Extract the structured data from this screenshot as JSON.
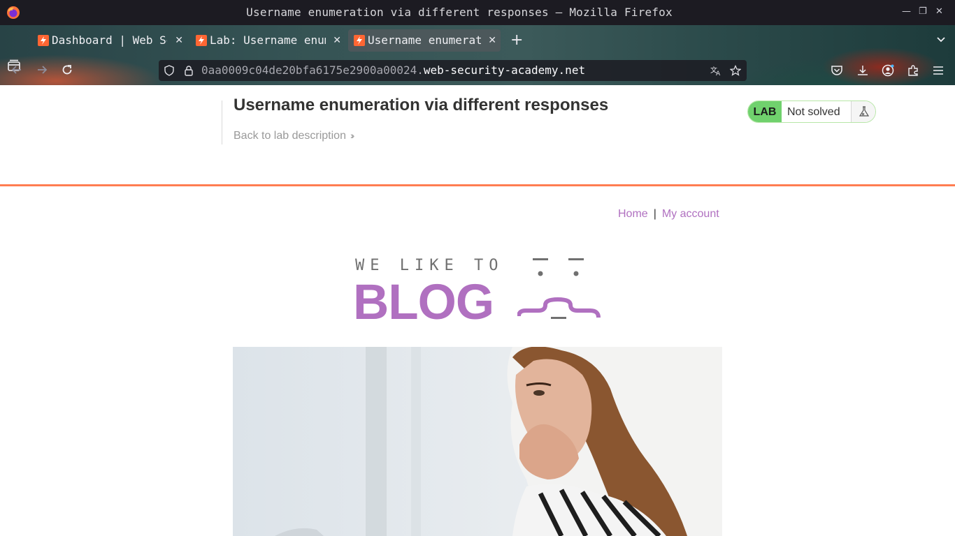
{
  "window": {
    "title": "Username enumeration via different responses — Mozilla Firefox"
  },
  "tabs": [
    {
      "label": "Dashboard | Web Se",
      "active": false
    },
    {
      "label": "Lab: Username enum",
      "active": false
    },
    {
      "label": "Username enumerat",
      "active": true
    }
  ],
  "urlbar": {
    "subdomain": "0aa0009c04de20bfa6175e2900a00024.",
    "domain": "web-security-academy.net"
  },
  "lab": {
    "title": "Username enumeration via different responses",
    "back_link": "Back to lab description",
    "tag": "LAB",
    "status": "Not solved"
  },
  "blog": {
    "nav": {
      "home": "Home",
      "separator": "|",
      "account": "My account"
    },
    "banner_line1": "WE LIKE TO",
    "banner_line2": "BLOG"
  },
  "colors": {
    "accent_purple": "#b070c0",
    "lab_green": "#70d16d",
    "orange_rule": "#ff6633"
  }
}
